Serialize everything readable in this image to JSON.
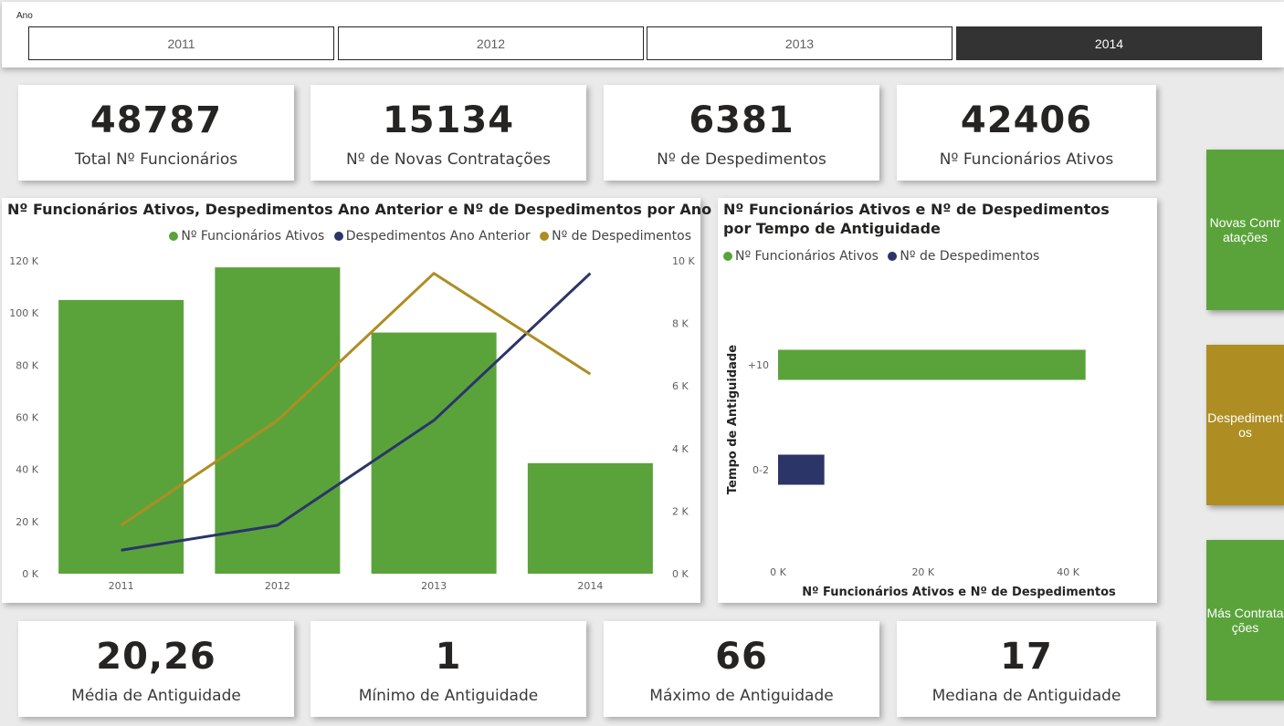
{
  "slicer": {
    "title": "Ano",
    "years": [
      "2011",
      "2012",
      "2013",
      "2014"
    ],
    "selected": "2014"
  },
  "kpis_top": [
    {
      "value": "48787",
      "label": "Total Nº Funcionários"
    },
    {
      "value": "15134",
      "label": "Nº de Novas Contratações"
    },
    {
      "value": "6381",
      "label": "Nº de Despedimentos"
    },
    {
      "value": "42406",
      "label": "Nº Funcionários Ativos"
    }
  ],
  "kpis_bottom": [
    {
      "value": "20,26",
      "label": "Média de Antiguidade"
    },
    {
      "value": "1",
      "label": "Mínimo de Antiguidade"
    },
    {
      "value": "66",
      "label": "Máximo de Antiguidade"
    },
    {
      "value": "17",
      "label": "Mediana de Antiguidade"
    }
  ],
  "nav_buttons": [
    {
      "label": "Novas Contratações",
      "color": "#5aa33b"
    },
    {
      "label": "Despedimentos",
      "color": "#ae8e22"
    },
    {
      "label": "Más Contratações",
      "color": "#5aa33b"
    }
  ],
  "colors": {
    "green": "#5aa33b",
    "navy": "#2b3568",
    "gold": "#ae8e22"
  },
  "chart_data": [
    {
      "type": "bar",
      "title": "Nº Funcionários Ativos, Despedimentos Ano Anterior e Nº de Despedimentos por Ano",
      "categories": [
        "2011",
        "2012",
        "2013",
        "2014"
      ],
      "series": [
        {
          "name": "Nº Funcionários Ativos",
          "kind": "bar",
          "axis": "left",
          "color": "#5aa33b",
          "values": [
            105000,
            117500,
            92500,
            42406
          ]
        },
        {
          "name": "Despedimentos Ano Anterior",
          "kind": "line",
          "axis": "right",
          "color": "#2b3568",
          "values": [
            750,
            1550,
            4900,
            9600
          ]
        },
        {
          "name": "Nº de Despedimentos",
          "kind": "line",
          "axis": "right",
          "color": "#ae8e22",
          "values": [
            1550,
            4900,
            9600,
            6381
          ]
        }
      ],
      "y_left": {
        "ticks": [
          "0 K",
          "20 K",
          "40 K",
          "60 K",
          "80 K",
          "100 K",
          "120 K"
        ],
        "range": [
          0,
          120000
        ]
      },
      "y_right": {
        "ticks": [
          "0 K",
          "2 K",
          "4 K",
          "6 K",
          "8 K",
          "10 K"
        ],
        "range": [
          0,
          10000
        ]
      },
      "legend_position": "top-right",
      "grid": false
    },
    {
      "type": "bar",
      "orientation": "horizontal",
      "title": "Nº Funcionários Ativos e Nº de Despedimentos por Tempo de Antiguidade",
      "categories": [
        "+10",
        "0-2"
      ],
      "series": [
        {
          "name": "Nº Funcionários Ativos",
          "color": "#5aa33b",
          "values": [
            42406,
            0
          ]
        },
        {
          "name": "Nº de Despedimentos",
          "color": "#2b3568",
          "values": [
            0,
            6381
          ]
        }
      ],
      "ylabel": "Tempo de Antiguidade",
      "xlabel": "Nº Funcionários Ativos e Nº de Despedimentos",
      "x_ticks": [
        "0 K",
        "20 K",
        "40 K"
      ],
      "x_range": [
        0,
        50000
      ],
      "legend_position": "top-left",
      "grid": false
    }
  ]
}
